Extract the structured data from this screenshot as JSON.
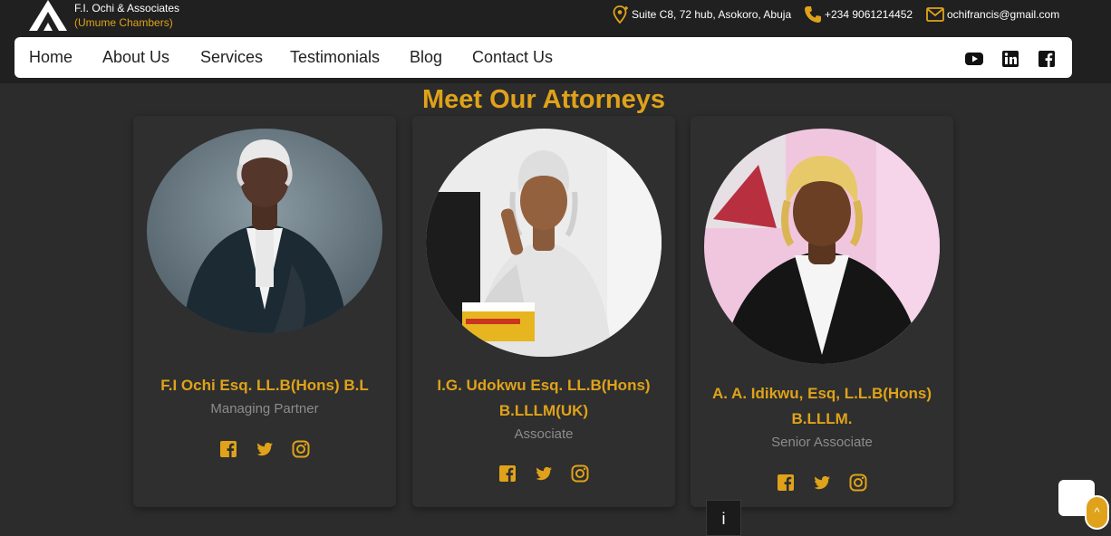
{
  "header": {
    "brand_name": "F.I. Ochi & Associates",
    "brand_sub": "(Umume Chambers)",
    "address": "Suite C8, 72 hub, Asokoro, Abuja",
    "phone": "+234 9061214452",
    "email": "ochifrancis@gmail.com"
  },
  "nav": {
    "items": [
      "Home",
      "About Us",
      "Services",
      "Testimonials",
      "Blog",
      "Contact Us"
    ],
    "socials": [
      "youtube-icon",
      "linkedin-icon",
      "facebook-icon"
    ]
  },
  "main": {
    "heading": "Meet Our Attorneys",
    "attorneys": [
      {
        "name_line1": "F.I Ochi Esq. LL.B(Hons) B.L",
        "name_line2": "",
        "role": "Managing Partner"
      },
      {
        "name_line1": "I.G. Udokwu Esq. LL.B(Hons)",
        "name_line2": "B.LLLM(UK)",
        "role": "Associate"
      },
      {
        "name_line1": "A. A. Idikwu, Esq, L.L.B(Hons)",
        "name_line2": "B.LLLM.",
        "role": "Senior Associate"
      }
    ],
    "card_socials": [
      "facebook-icon",
      "twitter-icon",
      "instagram-icon"
    ]
  },
  "widgets": {
    "info_label": "i",
    "scroll_top_label": "^"
  },
  "colors": {
    "accent": "#e0a21a",
    "background": "#2b2c2b",
    "topbar": "#1f201f",
    "muted": "#8c8c8c"
  }
}
